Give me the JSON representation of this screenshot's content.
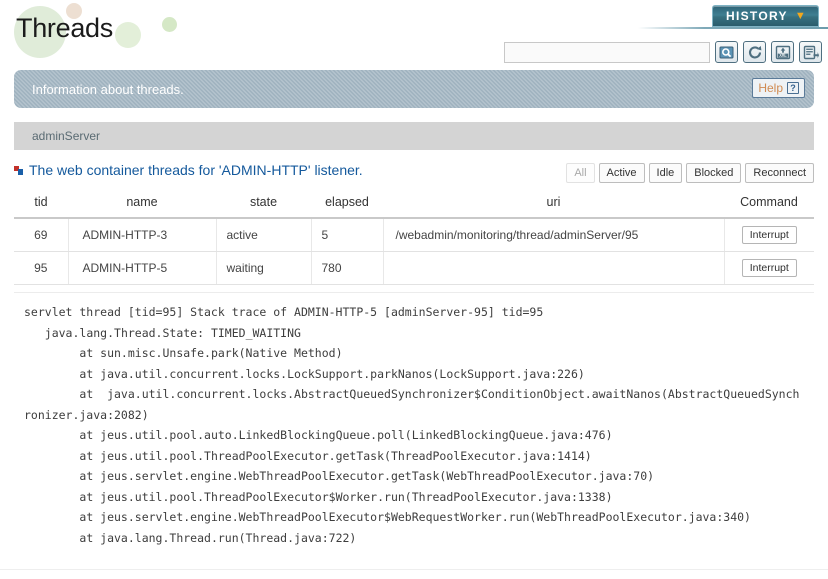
{
  "header": {
    "page_title": "Threads",
    "history_label": "HISTORY",
    "history_chevron_icon": "chevron-down-icon",
    "search_placeholder": "",
    "search_value": "",
    "toolbar_buttons": [
      {
        "name": "search-icon",
        "title": "Search"
      },
      {
        "name": "refresh-icon",
        "title": "Refresh"
      },
      {
        "name": "xml-export-icon",
        "title": "Export XML"
      },
      {
        "name": "export-icon",
        "title": "Export"
      }
    ]
  },
  "info_banner": {
    "text": "Information about threads.",
    "help_label": "Help",
    "help_mark": "?"
  },
  "server_bar": {
    "server_name": "adminServer"
  },
  "section": {
    "bullet_icon": "square-bullet-icon",
    "title": "The web container threads for 'ADMIN-HTTP' listener.",
    "filters": [
      {
        "label": "All",
        "state": "disabled"
      },
      {
        "label": "Active",
        "state": "enabled"
      },
      {
        "label": "Idle",
        "state": "enabled"
      },
      {
        "label": "Blocked",
        "state": "enabled"
      },
      {
        "label": "Reconnect",
        "state": "enabled"
      }
    ]
  },
  "table": {
    "columns": [
      "tid",
      "name",
      "state",
      "elapsed",
      "uri",
      "Command"
    ],
    "rows": [
      {
        "tid": "69",
        "name": "ADMIN-HTTP-3",
        "state": "active",
        "elapsed": "5",
        "uri": "/webadmin/monitoring/thread/adminServer/95",
        "command": "Interrupt"
      },
      {
        "tid": "95",
        "name": "ADMIN-HTTP-5",
        "state": "waiting",
        "elapsed": "780",
        "uri": "",
        "command": "Interrupt"
      }
    ]
  },
  "stack_trace": {
    "text": "servlet thread [tid=95] Stack trace of ADMIN-HTTP-5 [adminServer-95] tid=95\n   java.lang.Thread.State: TIMED_WAITING\n        at sun.misc.Unsafe.park(Native Method)\n        at java.util.concurrent.locks.LockSupport.parkNanos(LockSupport.java:226)\n        at  java.util.concurrent.locks.AbstractQueuedSynchronizer$ConditionObject.awaitNanos(AbstractQueuedSynchronizer.java:2082)\n        at jeus.util.pool.auto.LinkedBlockingQueue.poll(LinkedBlockingQueue.java:476)\n        at jeus.util.pool.ThreadPoolExecutor.getTask(ThreadPoolExecutor.java:1414)\n        at jeus.servlet.engine.WebThreadPoolExecutor.getTask(WebThreadPoolExecutor.java:70)\n        at jeus.util.pool.ThreadPoolExecutor$Worker.run(ThreadPoolExecutor.java:1338)\n        at jeus.servlet.engine.WebThreadPoolExecutor$WebRequestWorker.run(WebThreadPoolExecutor.java:340)\n        at java.lang.Thread.run(Thread.java:722)"
  },
  "colors": {
    "accent_blue": "#14599c",
    "banner_grey": "#9fb2bf",
    "history_teal": "#37707f",
    "history_chevron": "#f3a81c",
    "help_orange": "#d08b52",
    "server_bar": "#d4d4d4"
  }
}
